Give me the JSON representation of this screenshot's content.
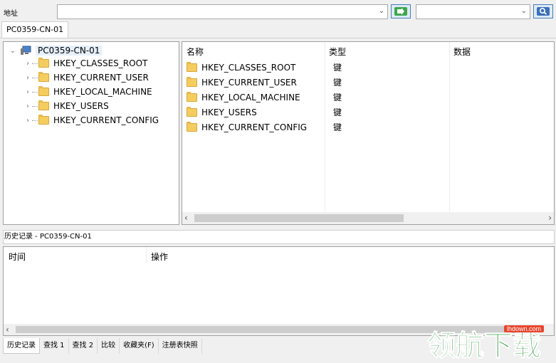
{
  "address": {
    "label": "地址",
    "value": ""
  },
  "search": {
    "value": ""
  },
  "top_tab": "PC0359-CN-01",
  "tree": {
    "root": "PC0359-CN-01",
    "nodes": [
      "HKEY_CLASSES_ROOT",
      "HKEY_CURRENT_USER",
      "HKEY_LOCAL_MACHINE",
      "HKEY_USERS",
      "HKEY_CURRENT_CONFIG"
    ]
  },
  "list": {
    "columns": [
      "名称",
      "类型",
      "数据"
    ],
    "rows": [
      {
        "name": "HKEY_CLASSES_ROOT",
        "type": "键"
      },
      {
        "name": "HKEY_CURRENT_USER",
        "type": "键"
      },
      {
        "name": "HKEY_LOCAL_MACHINE",
        "type": "键"
      },
      {
        "name": "HKEY_USERS",
        "type": "键"
      },
      {
        "name": "HKEY_CURRENT_CONFIG",
        "type": "键"
      }
    ]
  },
  "history": {
    "title": "历史记录 - PC0359-CN-01",
    "columns": [
      "时间",
      "操作"
    ]
  },
  "bottom_tabs": [
    "历史记录",
    "查找 1",
    "查找 2",
    "比较",
    "收藏夹(F)",
    "注册表快照"
  ],
  "watermark": {
    "text": "领航下载",
    "site": "lhdown.com"
  },
  "colors": {
    "folder": "#f5cd5e",
    "selection": "#e5f0fb",
    "button": "#dcebf8"
  }
}
